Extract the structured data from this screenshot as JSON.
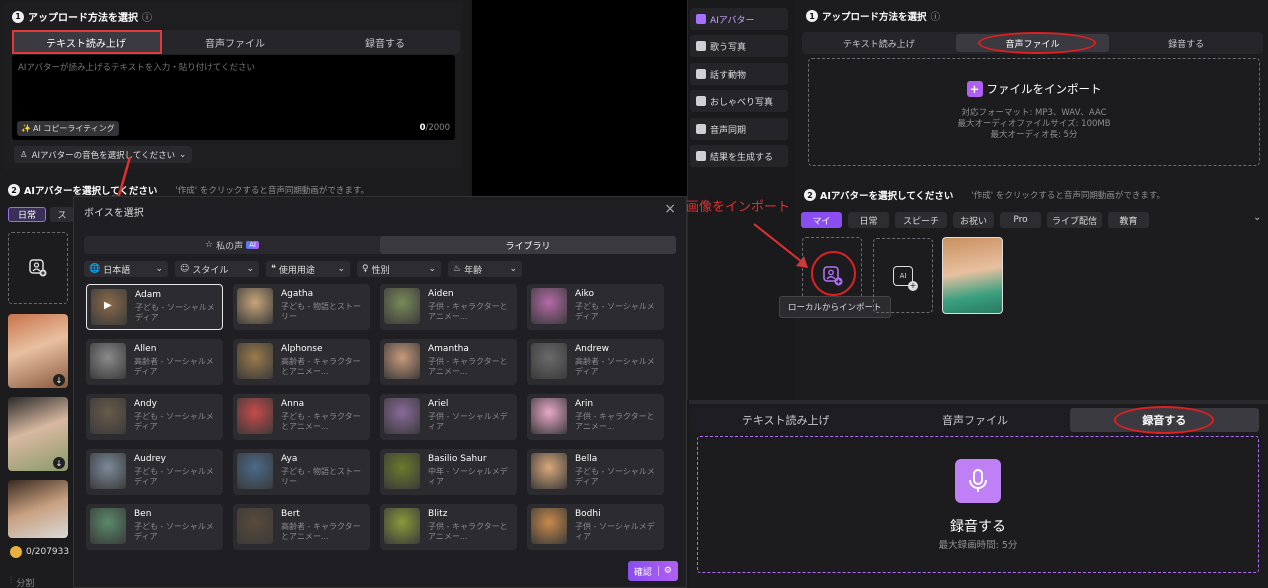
{
  "left": {
    "step1_num": "1",
    "step1_title": "アップロード方法を選択",
    "info_icon": "ⓘ",
    "tabs": [
      "テキスト読み上げ",
      "音声ファイル",
      "録音する"
    ],
    "textarea_placeholder": "AIアバターが読み上げるテキストを入力・貼り付けてください",
    "copywriting_btn": "AI コピーライティング",
    "counter_value": "0",
    "counter_max": "/2000",
    "voice_select": "AIアバターの音色を選択してください",
    "step2_num": "2",
    "step2_title": "AIアバターを選択してください",
    "step2_hint": "'作成' をクリックすると音声同期動画ができます。",
    "category_tabs": [
      "日常",
      "ス"
    ],
    "credits": "0/207933",
    "split_label": "分割"
  },
  "modal": {
    "title": "ボイスを選択",
    "close": "×",
    "tabs": [
      {
        "label": "私の声",
        "badge": "AI"
      },
      {
        "label": "ライブラリ"
      }
    ],
    "filters": [
      "日本語",
      "スタイル",
      "使用用途",
      "性別",
      "年齢"
    ],
    "voices": [
      {
        "name": "Adam",
        "desc": "子ども - ソーシャルメディア",
        "color": "#8a6a4a"
      },
      {
        "name": "Agatha",
        "desc": "子ども - 物語とストーリー",
        "color": "#c8a57a"
      },
      {
        "name": "Aiden",
        "desc": "子供 - キャラクターとアニメー...",
        "color": "#7a8a5a"
      },
      {
        "name": "Aiko",
        "desc": "子ども - ソーシャルメディア",
        "color": "#b56aa8"
      },
      {
        "name": "Allen",
        "desc": "高齢者 - ソーシャルメディア",
        "color": "#8a8a8a"
      },
      {
        "name": "Alphonse",
        "desc": "高齢者 - キャラクターとアニメー...",
        "color": "#9a7a4a"
      },
      {
        "name": "Amantha",
        "desc": "子供 - キャラクターとアニメー...",
        "color": "#c89a7a"
      },
      {
        "name": "Andrew",
        "desc": "高齢者 - ソーシャルメディア",
        "color": "#6a6a6a"
      },
      {
        "name": "Andy",
        "desc": "子ども - ソーシャルメディア",
        "color": "#6a5a4a"
      },
      {
        "name": "Anna",
        "desc": "子ども - キャラクターとアニメー...",
        "color": "#c84a4a"
      },
      {
        "name": "Ariel",
        "desc": "子供 - ソーシャルメディア",
        "color": "#8a6a9a"
      },
      {
        "name": "Arin",
        "desc": "子供 - キャラクターとアニメー...",
        "color": "#e8a8c8"
      },
      {
        "name": "Audrey",
        "desc": "子ども - ソーシャルメディア",
        "color": "#7a8a9a"
      },
      {
        "name": "Aya",
        "desc": "子ども - 物語とストーリー",
        "color": "#4a6a8a"
      },
      {
        "name": "Basilio Sahur",
        "desc": "中年 - ソーシャルメディア",
        "color": "#6a7a2a"
      },
      {
        "name": "Bella",
        "desc": "子ども - ソーシャルメディア",
        "color": "#d8a87a"
      },
      {
        "name": "Ben",
        "desc": "子ども - ソーシャルメディア",
        "color": "#5a8a6a"
      },
      {
        "name": "Bert",
        "desc": "高齢者 - キャラクターとアニメー...",
        "color": "#5a4a3a"
      },
      {
        "name": "Blitz",
        "desc": "子供 - キャラクターとアニメー...",
        "color": "#8a9a3a"
      },
      {
        "name": "Bodhi",
        "desc": "子供 - ソーシャルメディア",
        "color": "#c88a4a"
      }
    ],
    "confirm": "確認"
  },
  "sidebar": {
    "items": [
      "AIアバター",
      "歌う写真",
      "話す動物",
      "おしゃべり写真",
      "音声同期",
      "結果を生成する"
    ]
  },
  "right": {
    "step1_num": "1",
    "step1_title": "アップロード方法を選択",
    "info_icon": "ⓘ",
    "tabs": [
      "テキスト読み上げ",
      "音声ファイル",
      "録音する"
    ],
    "plus": "+",
    "import_label": "ファイルをインポート",
    "formats": "対応フォーマット: MP3、WAV、AAC",
    "max_size": "最大オーディオファイルサイズ: 100MB",
    "max_length": "最大オーディオ長: 5分",
    "step2_num": "2",
    "step2_title": "AIアバターを選択してください",
    "step2_hint": "'作成' をクリックすると音声同期動画ができます。",
    "categories": [
      "マイ",
      "日常",
      "スピーチ",
      "お祝い",
      "Pro",
      "ライブ配信",
      "教育"
    ],
    "annotation": "画像をインポート",
    "tooltip": "ローカルからインポート",
    "ai_icon": "AI"
  },
  "bottom": {
    "tabs": [
      "テキスト読み上げ",
      "音声ファイル",
      "録音する"
    ],
    "record_title": "録音する",
    "record_max": "最大録画時間: 5分"
  }
}
